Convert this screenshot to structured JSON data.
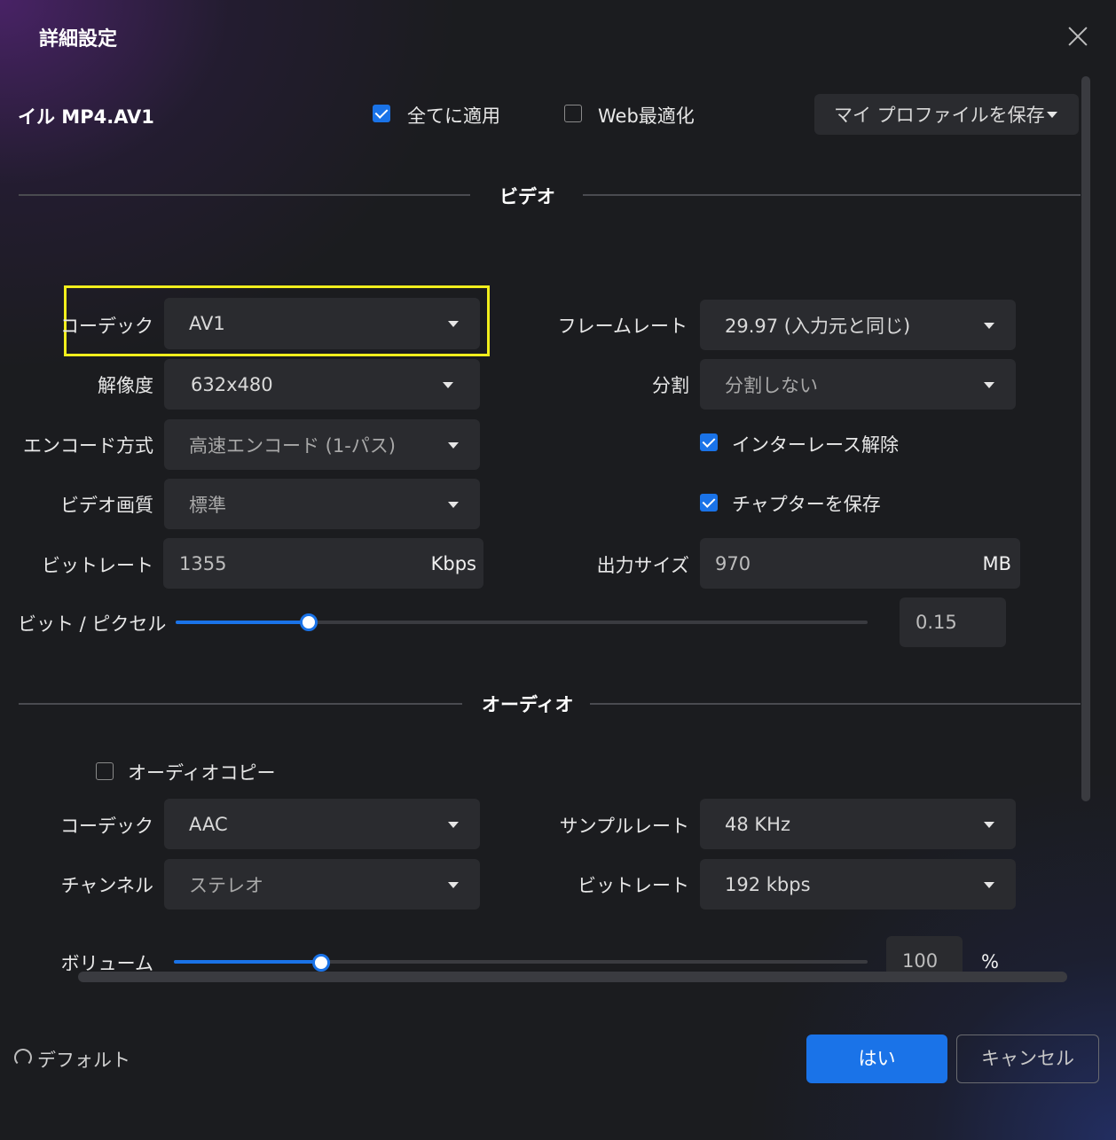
{
  "dialog": {
    "title": "詳細設定",
    "close_icon": "close-icon"
  },
  "top": {
    "format_label": "イル MP4.AV1",
    "apply_all": {
      "label": "全てに適用",
      "checked": true
    },
    "web_optimize": {
      "label": "Web最適化",
      "checked": false
    },
    "profile_select": "マイ プロファイルを保存"
  },
  "video": {
    "section_title": "ビデオ",
    "codec": {
      "label": "コーデック",
      "value": "AV1"
    },
    "resolution": {
      "label": "解像度",
      "value": "632x480"
    },
    "encode_mode": {
      "label": "エンコード方式",
      "value": "高速エンコード (1-パス)"
    },
    "quality": {
      "label": "ビデオ画質",
      "value": "標準"
    },
    "bitrate": {
      "label": "ビットレート",
      "value": "1355",
      "unit": "Kbps"
    },
    "bits_per_pixel": {
      "label": "ビット / ピクセル",
      "value": "0.15",
      "slider_fraction": 0.19
    },
    "framerate": {
      "label": "フレームレート",
      "value": "29.97 (入力元と同じ)"
    },
    "split": {
      "label": "分割",
      "value": "分割しない"
    },
    "deinterlace": {
      "label": "インターレース解除",
      "checked": true
    },
    "keep_chapters": {
      "label": "チャプターを保存",
      "checked": true
    },
    "output_size": {
      "label": "出力サイズ",
      "value": "970",
      "unit": "MB"
    }
  },
  "audio": {
    "section_title": "オーディオ",
    "audio_copy": {
      "label": "オーディオコピー",
      "checked": false
    },
    "codec": {
      "label": "コーデック",
      "value": "AAC"
    },
    "channel": {
      "label": "チャンネル",
      "value": "ステレオ"
    },
    "sample_rate": {
      "label": "サンプルレート",
      "value": "48 KHz"
    },
    "bitrate": {
      "label": "ビットレート",
      "value": "192 kbps"
    },
    "volume": {
      "label": "ボリューム",
      "value": "100",
      "unit": "%",
      "slider_fraction": 0.21
    }
  },
  "footer": {
    "default_label": "デフォルト",
    "yes_label": "はい",
    "cancel_label": "キャンセル"
  },
  "colors": {
    "accent": "#1a73e8",
    "highlight": "#f1ee1c",
    "background": "#1b1c1f",
    "control": "#2a2b2f"
  }
}
